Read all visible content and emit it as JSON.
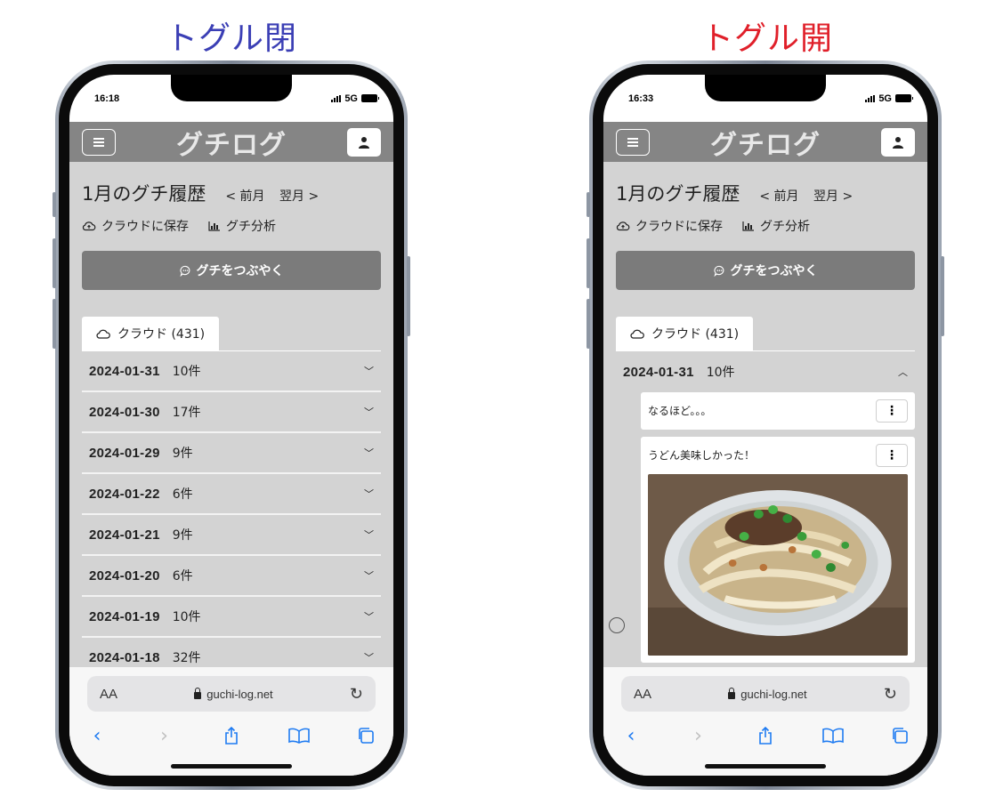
{
  "captions": {
    "left": "トグル閉",
    "right": "トグル開"
  },
  "phones": [
    {
      "time": "16:18",
      "network": "5G"
    },
    {
      "time": "16:33",
      "network": "5G"
    }
  ],
  "app": {
    "logo": "グチログ",
    "page_title": "1月のグチ履歴",
    "prev_month": "< 前月",
    "next_month": "翌月 >",
    "save_cloud": "クラウドに保存",
    "analysis": "グチ分析",
    "post_button": "グチをつぶやく",
    "tab_cloud": "クラウド (431)"
  },
  "left_dates": [
    {
      "date": "2024-01-31",
      "count": "10件"
    },
    {
      "date": "2024-01-30",
      "count": "17件"
    },
    {
      "date": "2024-01-29",
      "count": "9件"
    },
    {
      "date": "2024-01-22",
      "count": "6件"
    },
    {
      "date": "2024-01-21",
      "count": "9件"
    },
    {
      "date": "2024-01-20",
      "count": "6件"
    },
    {
      "date": "2024-01-19",
      "count": "10件"
    },
    {
      "date": "2024-01-18",
      "count": "32件"
    }
  ],
  "right_open": {
    "date": "2024-01-31",
    "count": "10件",
    "posts": [
      {
        "text": "なるほど。。。"
      },
      {
        "text": "うどん美味しかった！"
      }
    ]
  },
  "safari": {
    "aa": "AA",
    "url": "guchi-log.net"
  }
}
